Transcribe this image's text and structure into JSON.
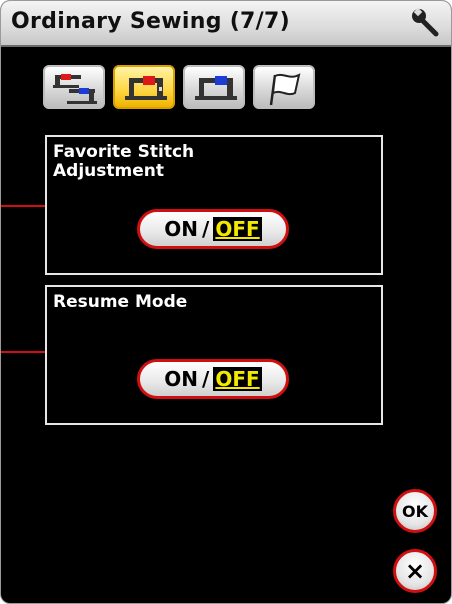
{
  "header": {
    "title": "Ordinary Sewing (7/7)",
    "settings_icon": "wrench-icon"
  },
  "tabs": [
    {
      "name": "machine-overview",
      "icon": "sewing-machine-multi-icon",
      "active": false
    },
    {
      "name": "machine-settings",
      "icon": "sewing-machine-red-icon",
      "active": true
    },
    {
      "name": "machine-blue",
      "icon": "sewing-machine-blue-icon",
      "active": false
    },
    {
      "name": "flag",
      "icon": "flag-icon",
      "active": false
    }
  ],
  "settings": [
    {
      "title": "Favorite Stitch\nAdjustment",
      "toggle": {
        "on": "ON",
        "separator": "/",
        "off": "OFF",
        "selected": "OFF"
      }
    },
    {
      "title": "Resume Mode",
      "toggle": {
        "on": "ON",
        "separator": "/",
        "off": "OFF",
        "selected": "OFF"
      }
    }
  ],
  "buttons": {
    "ok": "OK",
    "close": "×"
  },
  "colors": {
    "background": "#000000",
    "accent_red": "#d01010",
    "selected_yellow": "#f2e800",
    "active_tab": "#ffd84a"
  }
}
